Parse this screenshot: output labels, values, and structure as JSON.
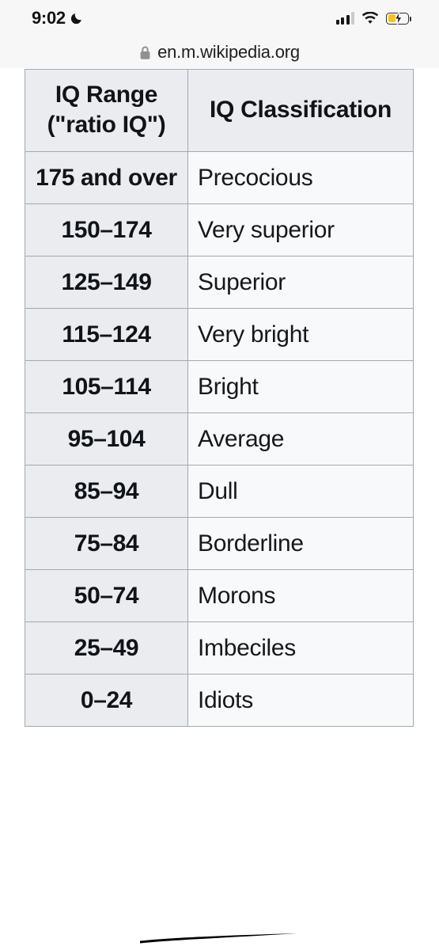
{
  "status_bar": {
    "time": "9:02",
    "moon_icon": "crescent-moon-icon",
    "cellular_icon": "cellular-signal-icon",
    "cellular_bars_filled": 3,
    "cellular_bars_total": 4,
    "wifi_icon": "wifi-icon",
    "battery_icon": "battery-charging-low-power-icon",
    "battery_color": "#f5c518"
  },
  "browser": {
    "lock_icon": "lock-icon",
    "url": "en.m.wikipedia.org"
  },
  "table": {
    "headers": [
      "IQ Range (\"ratio IQ\")",
      "IQ Classification"
    ],
    "rows": [
      {
        "range": "175 and over",
        "classification": "Precocious"
      },
      {
        "range": "150–174",
        "classification": "Very superior"
      },
      {
        "range": "125–149",
        "classification": "Superior"
      },
      {
        "range": "115–124",
        "classification": "Very bright"
      },
      {
        "range": "105–114",
        "classification": "Bright"
      },
      {
        "range": "95–104",
        "classification": "Average"
      },
      {
        "range": "85–94",
        "classification": "Dull"
      },
      {
        "range": "75–84",
        "classification": "Borderline"
      },
      {
        "range": "50–74",
        "classification": "Morons"
      },
      {
        "range": "25–49",
        "classification": "Imbeciles"
      },
      {
        "range": "0–24",
        "classification": "Idiots"
      }
    ],
    "header_bg": "#eaecf0",
    "cell_bg": "#f8f9fa",
    "border_color": "#a2a9b1"
  },
  "annotation": {
    "name": "hand-drawn-underline",
    "color": "#000000"
  }
}
